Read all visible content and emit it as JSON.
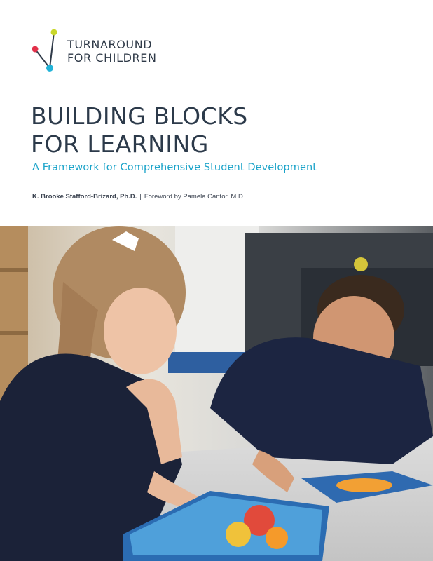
{
  "logo": {
    "line1": "TURNAROUND",
    "line2": "FOR CHILDREN"
  },
  "title": {
    "line1": "BUILDING BLOCKS",
    "line2": "FOR LEARNING"
  },
  "subtitle": "A Framework for Comprehensive Student Development",
  "byline": {
    "author": "K. Brooke Stafford-Brizard, Ph.D.",
    "separator": "|",
    "foreword": "Foreword by Pamela Cantor, M.D."
  },
  "colors": {
    "title": "#2c3a4a",
    "subtitle": "#1aa3c9",
    "logo_yellow": "#c9d72b",
    "logo_red": "#e2304a",
    "logo_cyan": "#22b3d8"
  }
}
